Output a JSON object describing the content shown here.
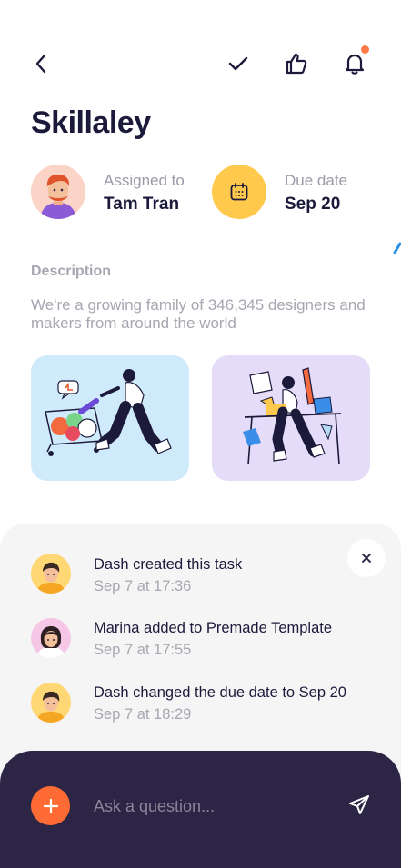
{
  "header": {
    "icons": [
      "chevron-left-icon",
      "check-icon",
      "thumbs-up-icon",
      "bell-icon"
    ],
    "notification_dot_color": "#ff7a45"
  },
  "task": {
    "title": "Skillaley",
    "assigned_label": "Assigned to",
    "assignee": "Tam Tran",
    "due_label": "Due date",
    "due_date": "Sep 20",
    "due_icon_bg": "#ffc94d"
  },
  "description": {
    "heading": "Description",
    "text": "We're a growing family of 346,345 designers and makers from around the world"
  },
  "attachments": [
    {
      "bg": "#cfeafb",
      "icon": "shopping-cart-illustration"
    },
    {
      "bg": "#e4dcf8",
      "icon": "designer-desk-illustration"
    }
  ],
  "activity": {
    "close_icon": "close-icon",
    "items": [
      {
        "text": "Dash created this task",
        "time": "Sep 7 at 17:36"
      },
      {
        "text": "Marina added to Premade Template",
        "time": "Sep 7 at 17:55"
      },
      {
        "text": "Dash changed the due date to Sep 20",
        "time": "Sep 7 at 18:29"
      }
    ]
  },
  "composer": {
    "placeholder": "Ask a question...",
    "plus_color": "#ff6b35",
    "send_icon": "send-icon"
  },
  "colors": {
    "primary_text": "#1c1a3a",
    "muted_text": "#a7a6b1",
    "composer_bg": "#2d2545"
  }
}
